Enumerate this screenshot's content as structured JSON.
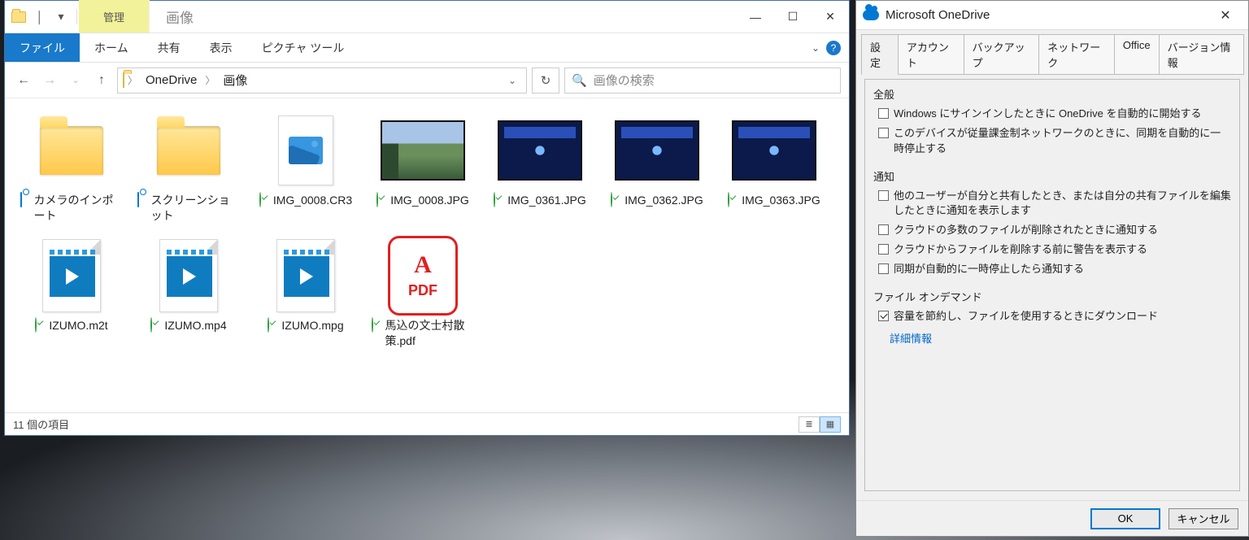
{
  "explorer": {
    "title": "画像",
    "manage_tab": "管理",
    "ribbon": {
      "file": "ファイル",
      "home": "ホーム",
      "share": "共有",
      "view": "表示",
      "picture_tools": "ピクチャ ツール"
    },
    "breadcrumbs": [
      "OneDrive",
      "画像"
    ],
    "search_placeholder": "画像の検索",
    "items": [
      {
        "name": "カメラのインポート",
        "sync": "cloud",
        "kind": "folder"
      },
      {
        "name": "スクリーンショット",
        "sync": "cloud",
        "kind": "folder"
      },
      {
        "name": "IMG_0008.CR3",
        "sync": "check",
        "kind": "image-generic"
      },
      {
        "name": "IMG_0008.JPG",
        "sync": "check",
        "kind": "photo1"
      },
      {
        "name": "IMG_0361.JPG",
        "sync": "check",
        "kind": "photo-dark"
      },
      {
        "name": "IMG_0362.JPG",
        "sync": "check",
        "kind": "photo-dark"
      },
      {
        "name": "IMG_0363.JPG",
        "sync": "check",
        "kind": "photo-dark"
      },
      {
        "name": "IZUMO.m2t",
        "sync": "check",
        "kind": "video"
      },
      {
        "name": "IZUMO.mp4",
        "sync": "check",
        "kind": "video"
      },
      {
        "name": "IZUMO.mpg",
        "sync": "check",
        "kind": "video"
      },
      {
        "name": "馬込の文士村散策.pdf",
        "sync": "check",
        "kind": "pdf"
      }
    ],
    "status": "11 個の項目"
  },
  "onedrive": {
    "title": "Microsoft OneDrive",
    "tabs": [
      "設定",
      "アカウント",
      "バックアップ",
      "ネットワーク",
      "Office",
      "バージョン情報"
    ],
    "groups": {
      "general": {
        "title": "全般",
        "opt1": "Windows にサインインしたときに OneDrive を自動的に開始する",
        "opt2": "このデバイスが従量課金制ネットワークのときに、同期を自動的に一時停止する"
      },
      "notify": {
        "title": "通知",
        "n1": "他のユーザーが自分と共有したとき、または自分の共有ファイルを編集したときに通知を表示します",
        "n2": "クラウドの多数のファイルが削除されたときに通知する",
        "n3": "クラウドからファイルを削除する前に警告を表示する",
        "n4": "同期が自動的に一時停止したら通知する"
      },
      "fod": {
        "title": "ファイル オンデマンド",
        "opt": "容量を節約し、ファイルを使用するときにダウンロード",
        "link": "詳細情報"
      }
    },
    "buttons": {
      "ok": "OK",
      "cancel": "キャンセル"
    }
  }
}
